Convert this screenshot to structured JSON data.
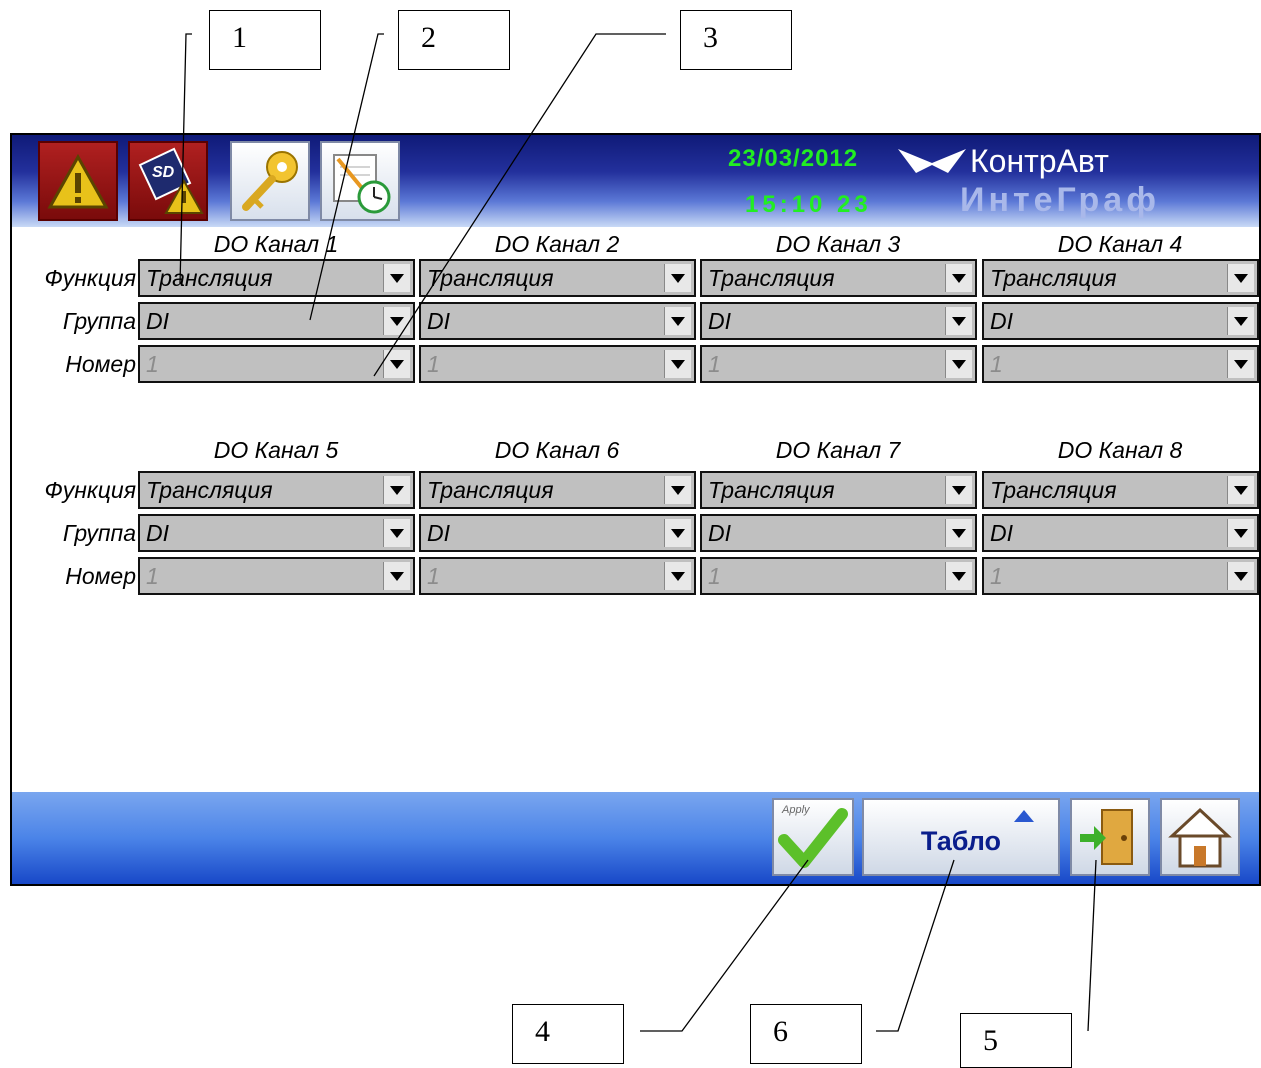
{
  "callouts": [
    "1",
    "2",
    "3",
    "4",
    "6",
    "5"
  ],
  "header": {
    "date": "23/03/2012",
    "time": "15:10 23",
    "brand_line1": "КонтрАвт",
    "brand_line2": "ИнтеГраф",
    "icons": [
      "alarm-warning-icon",
      "sd-card-warning-icon",
      "key-icon",
      "schedule-clock-icon"
    ]
  },
  "rows": {
    "function_label": "Функция",
    "group_label": "Группа",
    "number_label": "Номер"
  },
  "channels": [
    {
      "title": "DO Канал 1",
      "function": "Трансляция",
      "group": "DI",
      "number": "1"
    },
    {
      "title": "DO Канал 2",
      "function": "Трансляция",
      "group": "DI",
      "number": "1"
    },
    {
      "title": "DO Канал 3",
      "function": "Трансляция",
      "group": "DI",
      "number": "1"
    },
    {
      "title": "DO Канал 4",
      "function": "Трансляция",
      "group": "DI",
      "number": "1"
    },
    {
      "title": "DO Канал 5",
      "function": "Трансляция",
      "group": "DI",
      "number": "1"
    },
    {
      "title": "DO Канал 6",
      "function": "Трансляция",
      "group": "DI",
      "number": "1"
    },
    {
      "title": "DO Канал 7",
      "function": "Трансляция",
      "group": "DI",
      "number": "1"
    },
    {
      "title": "DO Канал 8",
      "function": "Трансляция",
      "group": "DI",
      "number": "1"
    }
  ],
  "footer": {
    "apply_label": "Apply",
    "tablo_label": "Табло",
    "icons": [
      "apply-checkmark-icon",
      "exit-door-icon",
      "home-icon"
    ]
  },
  "colors": {
    "header_dark": "#0f1a78",
    "clock_green": "#22ee22",
    "footer_blue": "#4b84e8",
    "dropdown_gray": "#c0c0c0"
  }
}
